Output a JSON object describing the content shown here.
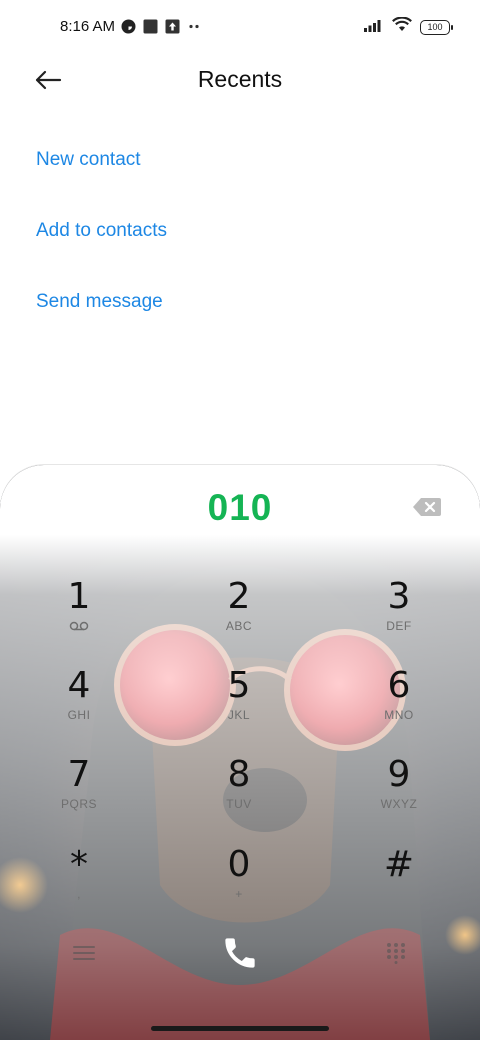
{
  "status_bar": {
    "time": "8:16 AM",
    "left_icons": [
      "compass-icon",
      "square-icon",
      "upload-icon",
      "more-dots-icon"
    ],
    "right_icons": [
      "signal-icon",
      "wifi-icon"
    ],
    "battery": "100"
  },
  "header": {
    "title": "Recents",
    "back_icon": "arrow-left-icon"
  },
  "actions": [
    "New contact",
    "Add to contacts",
    "Send message"
  ],
  "dialpad": {
    "number": "010",
    "keys": [
      {
        "digit": "1",
        "letters": "",
        "icon": "voicemail-icon"
      },
      {
        "digit": "2",
        "letters": "ABC"
      },
      {
        "digit": "3",
        "letters": "DEF"
      },
      {
        "digit": "4",
        "letters": "GHI"
      },
      {
        "digit": "5",
        "letters": "JKL"
      },
      {
        "digit": "6",
        "letters": "MNO"
      },
      {
        "digit": "7",
        "letters": "PQRS"
      },
      {
        "digit": "8",
        "letters": "TUV"
      },
      {
        "digit": "9",
        "letters": "WXYZ"
      },
      {
        "digit": "*",
        "letters": ","
      },
      {
        "digit": "0",
        "letters": "+"
      },
      {
        "digit": "#",
        "letters": ""
      }
    ],
    "bottom_icons": [
      "menu-icon",
      "call-icon",
      "dialpad-icon"
    ]
  },
  "colors": {
    "accent": "#1d87e4",
    "number": "#15b454",
    "text": "#111111"
  }
}
